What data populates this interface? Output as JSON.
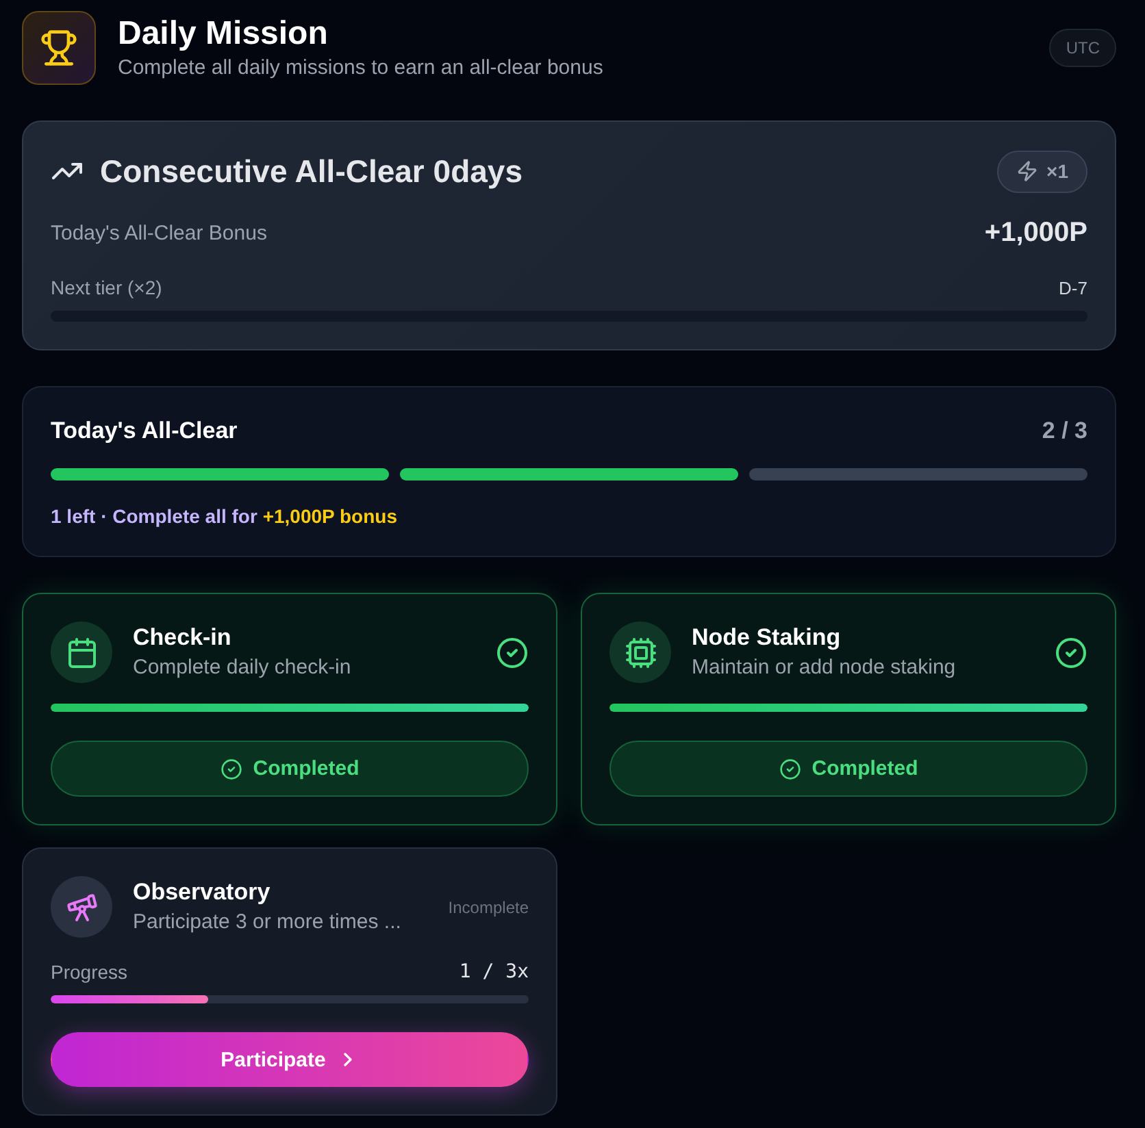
{
  "header": {
    "title": "Daily Mission",
    "subtitle": "Complete all daily missions to earn an all-clear bonus",
    "timezone": "UTC"
  },
  "streak": {
    "title": "Consecutive All-Clear 0days",
    "multiplier": "×1",
    "bonus_label": "Today's All-Clear Bonus",
    "bonus_value": "+1,000P",
    "next_tier_label": "Next tier (×2)",
    "next_tier_value": "D-7"
  },
  "all_clear": {
    "title": "Today's All-Clear",
    "count": "2 / 3",
    "steps": [
      {
        "completed": true
      },
      {
        "completed": true
      },
      {
        "completed": false
      }
    ],
    "note": "1 left · Complete all for",
    "note_highlight": "+1,000P bonus"
  },
  "missions": [
    {
      "title": "Check-in",
      "description": "Complete daily check-in",
      "completed": true,
      "level": 1,
      "button": "Completed"
    },
    {
      "title": "Node Staking",
      "description": "Maintain or add node staking",
      "completed": true,
      "level": 1,
      "button": "Completed"
    },
    {
      "title": "Observatory",
      "description": "Participate 3 or more times ...",
      "completed": false,
      "status": "Incomplete",
      "progress_label": "Progress",
      "reading": "1 / 3x",
      "level": 0.33,
      "button": "Participate"
    }
  ]
}
